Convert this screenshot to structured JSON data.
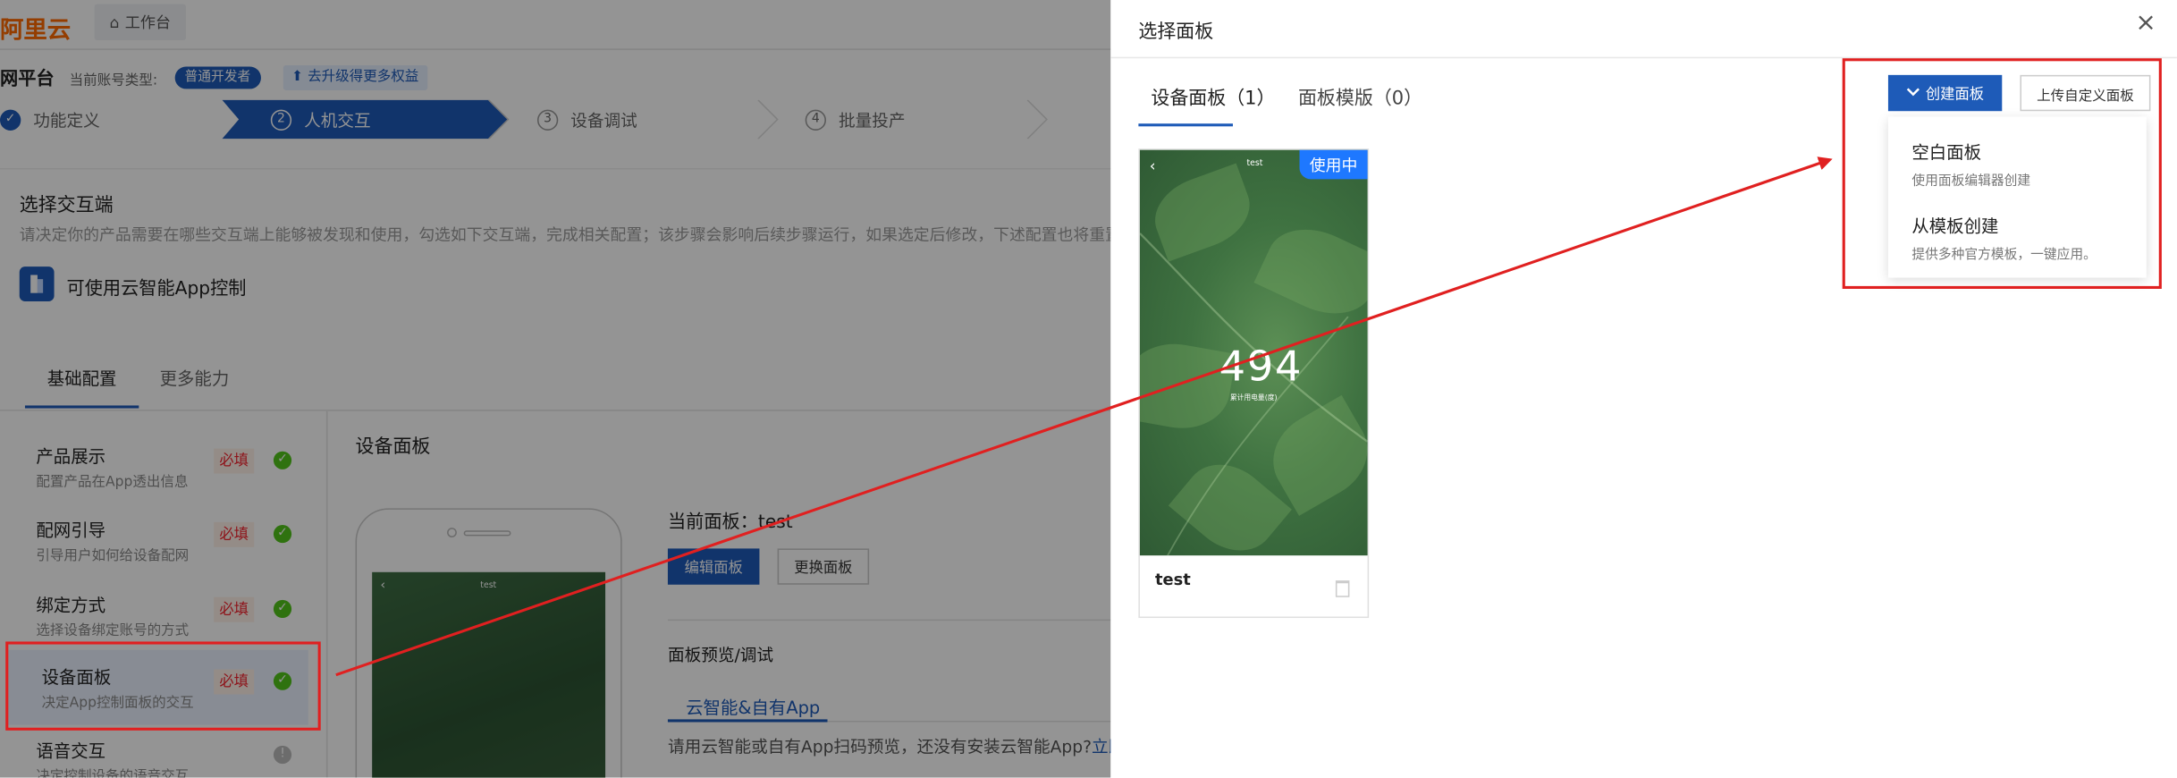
{
  "header": {
    "logo": "阿里云",
    "workspace_tab": "工作台",
    "platform_title": "网平台",
    "account_type_label": "当前账号类型:",
    "account_badge": "普通开发者",
    "upgrade_link": "去升级得更多权益"
  },
  "steps": [
    {
      "num": "",
      "label": "功能定义",
      "state": "done"
    },
    {
      "num": "2",
      "label": "人机交互",
      "state": "active"
    },
    {
      "num": "3",
      "label": "设备调试",
      "state": "pending"
    },
    {
      "num": "4",
      "label": "批量投产",
      "state": "pending"
    }
  ],
  "select_terminal": {
    "title": "选择交互端",
    "description": "请决定你的产品需要在哪些交互端上能够被发现和使用，勾选如下交互端，完成相关配置；该步骤会影响后续步骤运行，如果选定后修改，下述配置也将重置。",
    "app_option": "可使用云智能App控制"
  },
  "config_tabs": [
    "基础配置",
    "更多能力"
  ],
  "sidebar": {
    "items": [
      {
        "title": "产品展示",
        "desc": "配置产品在App透出信息",
        "required": "必填",
        "status": "done"
      },
      {
        "title": "配网引导",
        "desc": "引导用户如何给设备配网",
        "required": "必填",
        "status": "done"
      },
      {
        "title": "绑定方式",
        "desc": "选择设备绑定账号的方式",
        "required": "必填",
        "status": "done"
      },
      {
        "title": "设备面板",
        "desc": "决定App控制面板的交互",
        "required": "必填",
        "status": "done"
      },
      {
        "title": "语音交互",
        "desc": "决定控制设备的语音交互",
        "required": "",
        "status": "info"
      }
    ]
  },
  "main": {
    "section_title": "设备面板",
    "phone_header": "test",
    "current_panel_label": "当前面板：",
    "current_panel_value": "test",
    "edit_button": "编辑面板",
    "swap_button": "更换面板",
    "preview_label": "面板预览/调试",
    "app_tab": "云智能&自有App",
    "scan_hint": "请用云智能或自有App扫码预览，还没有安装云智能App?",
    "scan_link": "立即安装"
  },
  "drawer": {
    "title": "选择面板",
    "close": "×",
    "tabs": [
      {
        "label": "设备面板（1）",
        "active": true
      },
      {
        "label": "面板模版（0）",
        "active": false
      }
    ],
    "create_button": "创建面板",
    "upload_button": "上传自定义面板",
    "dropdown": [
      {
        "title": "空白面板",
        "desc": "使用面板编辑器创建"
      },
      {
        "title": "从模板创建",
        "desc": "提供多种官方模板，一键应用。"
      }
    ],
    "card": {
      "header": "test",
      "badge": "使用中",
      "big_value": "494",
      "sub_label": "累计用电量(度)",
      "name": "test"
    }
  },
  "colors": {
    "brand": "#ff6a00",
    "primary": "#1e5bb8",
    "annotation": "#e02020",
    "required": "#f5222d",
    "success": "#52c41a"
  }
}
